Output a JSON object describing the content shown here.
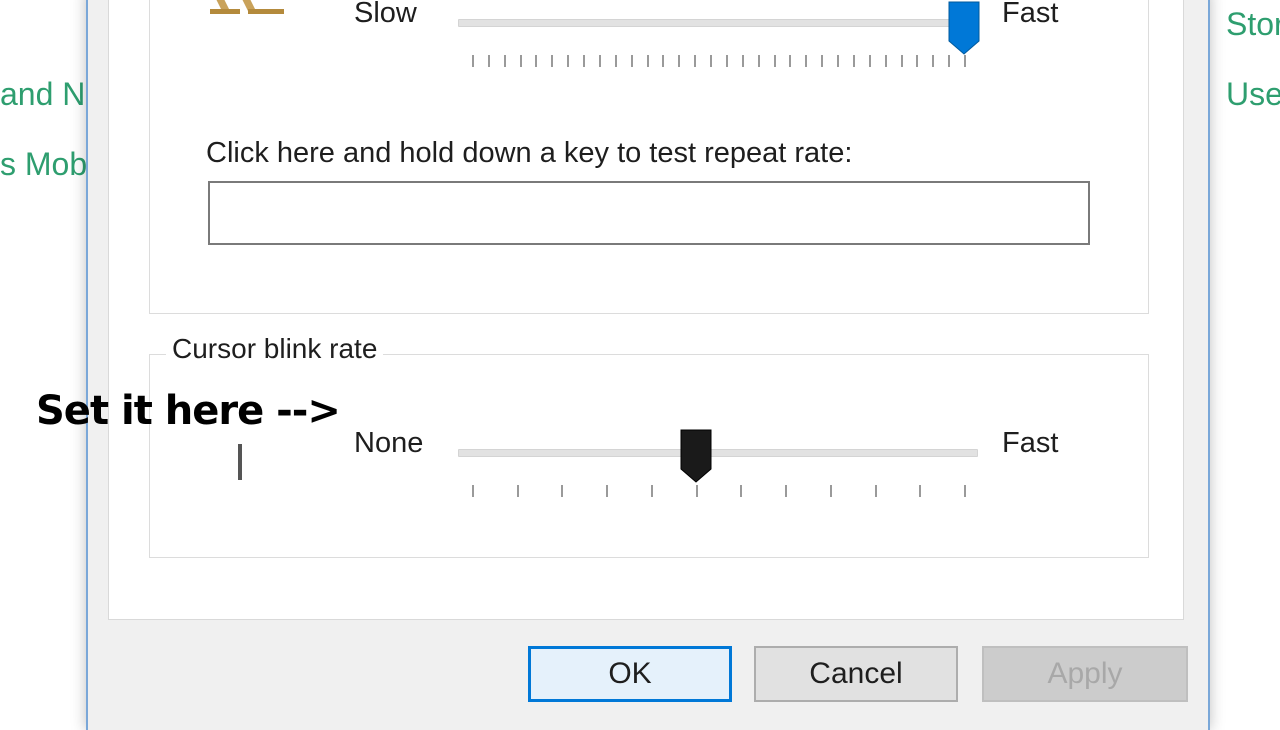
{
  "background_left": {
    "items": [
      "and N",
      "s Mob"
    ]
  },
  "background_right": {
    "items": [
      "Stor",
      "Use"
    ]
  },
  "repeat_rate": {
    "slow_label": "Slow",
    "fast_label": "Fast",
    "value_fraction": 1.0,
    "test_prompt": "Click here and hold down a key to test repeat rate:",
    "test_value": ""
  },
  "cursor_blink": {
    "group_label": "Cursor blink rate",
    "none_label": "None",
    "fast_label": "Fast",
    "value_fraction": 0.4545
  },
  "annotation": {
    "text": "Set it here -->"
  },
  "buttons": {
    "ok": "OK",
    "cancel": "Cancel",
    "apply": "Apply"
  },
  "colors": {
    "accent": "#0078d7",
    "blink_thumb": "#1a1a1a",
    "link_green": "#2e9e6f"
  }
}
